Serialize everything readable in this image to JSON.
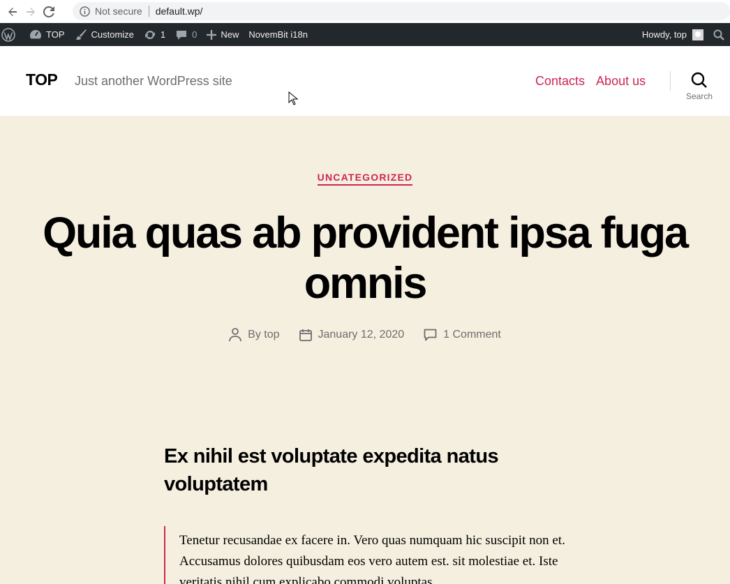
{
  "browser": {
    "security_label": "Not secure",
    "url": "default.wp/"
  },
  "admin_bar": {
    "site_name": "TOP",
    "customize": "Customize",
    "updates_count": "1",
    "comments_count": "0",
    "new_label": "New",
    "plugin_label": "NovemBit i18n",
    "howdy": "Howdy, top"
  },
  "header": {
    "site_title": "TOP",
    "site_description": "Just another WordPress site",
    "menu": [
      {
        "label": "Contacts"
      },
      {
        "label": "About us"
      }
    ],
    "search_label": "Search"
  },
  "post": {
    "category": "UNCATEGORIZED",
    "title": "Quia quas ab provident ipsa fuga omnis",
    "author": "By top",
    "date": "January 12, 2020",
    "comments": "1 Comment",
    "heading": "Ex nihil est voluptate expedita natus voluptatem",
    "quote": "Tenetur recusandae ex facere in. Vero quas numquam hic suscipit non et. Accusamus dolores quibusdam eos vero autem est. sit molestiae et. Iste veritatis nihil cum explicabo commodi voluptas"
  },
  "colors": {
    "accent": "#cd2653",
    "background": "#f5efe0",
    "admin_bar": "#23282d"
  }
}
